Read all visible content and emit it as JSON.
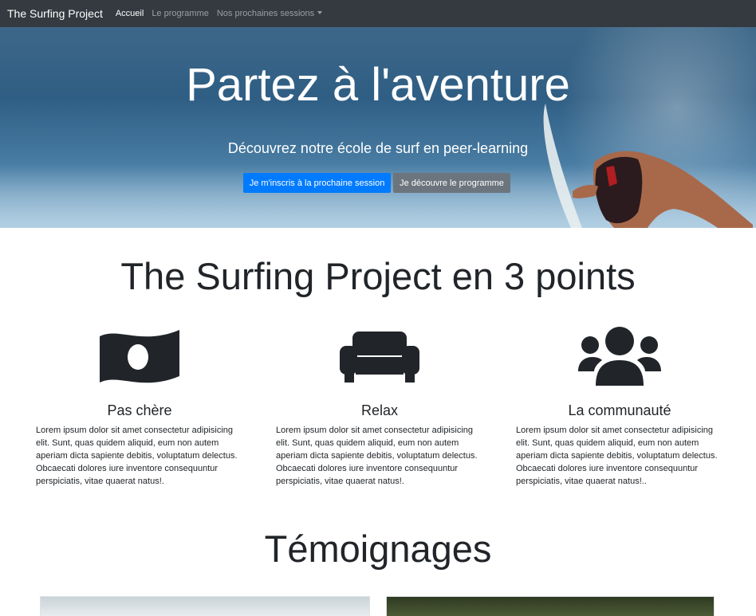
{
  "navbar": {
    "brand": "The Surfing Project",
    "links": [
      "Accueil",
      "Le programme",
      "Nos prochaines sessions"
    ]
  },
  "hero": {
    "title": "Partez à l'aventure",
    "subtitle": "Découvrez notre école de surf en peer-learning",
    "primary_button": "Je m'inscris à la prochaine session",
    "secondary_button": "Je découvre le programme"
  },
  "points": {
    "title": "The Surfing Project en 3 points",
    "items": [
      {
        "icon": "money-bill-icon",
        "title": "Pas chère",
        "text": "Lorem ipsum dolor sit amet consectetur adipisicing elit. Sunt, quas quidem aliquid, eum non autem aperiam dicta sapiente debitis, voluptatum delectus. Obcaecati dolores iure inventore consequuntur perspiciatis, vitae quaerat natus!."
      },
      {
        "icon": "couch-icon",
        "title": "Relax",
        "text": "Lorem ipsum dolor sit amet consectetur adipisicing elit. Sunt, quas quidem aliquid, eum non autem aperiam dicta sapiente debitis, voluptatum delectus. Obcaecati dolores iure inventore consequuntur perspiciatis, vitae quaerat natus!."
      },
      {
        "icon": "users-icon",
        "title": "La communauté",
        "text": "Lorem ipsum dolor sit amet consectetur adipisicing elit. Sunt, quas quidem aliquid, eum non autem aperiam dicta sapiente debitis, voluptatum delectus. Obcaecati dolores iure inventore consequuntur perspiciatis, vitae quaerat natus!.."
      }
    ]
  },
  "testimonials": {
    "title": "Témoignages"
  },
  "colors": {
    "navbar": "#343a40",
    "primary": "#007bff",
    "secondary": "#6c757d",
    "icon": "#212529"
  }
}
